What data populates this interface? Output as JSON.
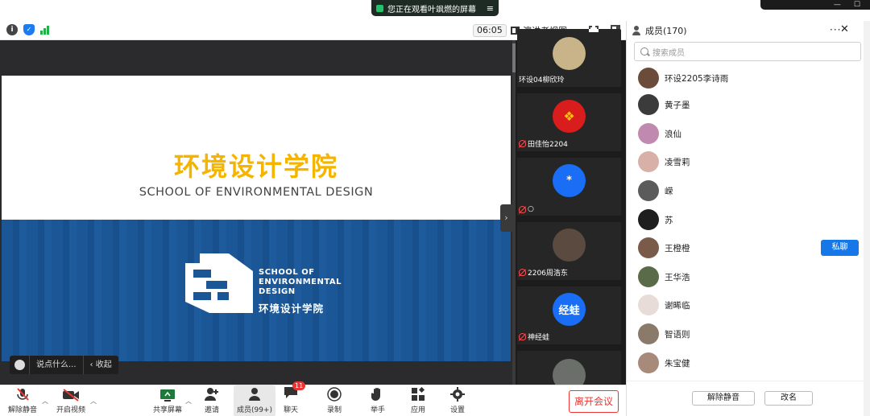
{
  "share_banner": {
    "text": "您正在观看叶飒燃的屏幕",
    "menu_icon": "hamburger-icon"
  },
  "toolbar": {
    "timer": "06:05",
    "view_label": "演讲者视图",
    "icons": [
      "info-icon",
      "shield-icon",
      "signal-icon",
      "fullscreen-icon",
      "side-panel-icon"
    ]
  },
  "slide": {
    "title_cn": "环境设计学院",
    "title_en": "SCHOOL OF ENVIRONMENTAL DESIGN",
    "logo_lines": [
      "SCHOOL OF",
      "ENVIRONMENTAL",
      "DESIGN"
    ],
    "logo_cn": "环境设计学院",
    "colors": {
      "title": "#f5b400",
      "banner": "#1b5797"
    }
  },
  "chat_bar": {
    "placeholder": "说点什么...",
    "collapse_label": "收起"
  },
  "gallery": [
    {
      "name": "环设04柳欣玲",
      "muted": false,
      "avatar_text": "",
      "avatar_color": "#c9b48a"
    },
    {
      "name": "田佳怡2204",
      "muted": true,
      "avatar_text": "",
      "avatar_color": "#d91d1d"
    },
    {
      "name": "○",
      "muted": true,
      "avatar_text": "*",
      "avatar_color": "#1a6ef5"
    },
    {
      "name": "2206周浩东",
      "muted": true,
      "avatar_text": "",
      "avatar_color": "#5a4a40"
    },
    {
      "name": "神经蛙",
      "muted": true,
      "avatar_text": "经蛙",
      "avatar_color": "#1a6ef5"
    },
    {
      "name": "",
      "muted": false,
      "avatar_text": "",
      "avatar_color": "#6b6f6a"
    }
  ],
  "controls": {
    "unmute": "解除静音",
    "start_video": "开启视频",
    "share_screen": "共享屏幕",
    "invite": "邀请",
    "members": "成员(99+)",
    "chat": "聊天",
    "chat_badge": "11",
    "record": "录制",
    "raise_hand": "举手",
    "apps": "应用",
    "settings": "设置",
    "leave": "离开会议"
  },
  "members_panel": {
    "title": "成员(170)",
    "search_placeholder": "搜索成员",
    "private_chat": "私聊",
    "footer": {
      "unmute_all": "解除静音",
      "rename": "改名"
    },
    "list": [
      {
        "name": "环设2205李诗雨",
        "color": "#6b4c3a"
      },
      {
        "name": "黄子墨",
        "color": "#3b3b3b"
      },
      {
        "name": "浪仙",
        "color": "#c08ab0"
      },
      {
        "name": "凌雪莉",
        "color": "#d8b0a8"
      },
      {
        "name": "嵘",
        "color": "#5b5b5b"
      },
      {
        "name": "苏",
        "color": "#1e1e1e"
      },
      {
        "name": "王橙橙",
        "color": "#7a5a48"
      },
      {
        "name": "王华浩",
        "color": "#5a6b4a"
      },
      {
        "name": "谢晞临",
        "color": "#e8dcd8"
      },
      {
        "name": "智语则",
        "color": "#8a7a6a"
      },
      {
        "name": "朱宝健",
        "color": "#a88a7a"
      }
    ]
  }
}
